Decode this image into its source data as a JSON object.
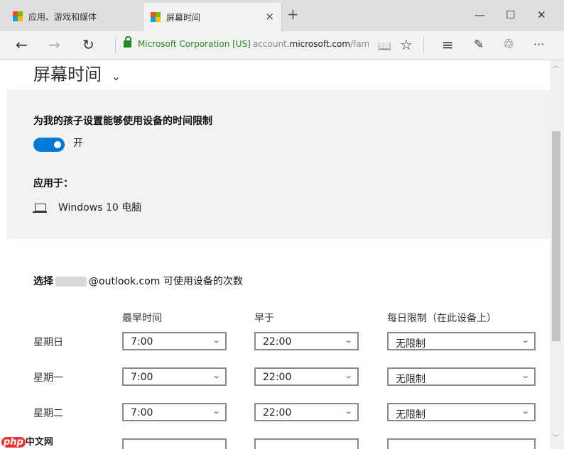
{
  "tabs": [
    {
      "label": "应用、游戏和媒体",
      "active": false
    },
    {
      "label": "屏幕时间",
      "active": true
    }
  ],
  "tab_close": "×",
  "new_tab": "+",
  "window_controls": {
    "minimize": "—",
    "maximize": "☐",
    "close": "✕"
  },
  "nav": {
    "back": "←",
    "forward": "→",
    "refresh": "↻",
    "cert_label": "Microsoft Corporation [US]",
    "url_prefix": "account.",
    "url_domain": "microsoft.com",
    "url_path": "/family",
    "reading_view": "📖",
    "favorite": "☆",
    "hub": "≡",
    "note": "✎",
    "share": "♲",
    "more": "···"
  },
  "page": {
    "title": "屏幕时间",
    "title_chevron": "⌄",
    "limit_heading": "为我的孩子设置能够使用设备的时间限制",
    "toggle": {
      "on": true,
      "label": "开"
    },
    "apply_heading": "应用于：",
    "device": "Windows 10 电脑",
    "schedule_heading_prefix": "选择",
    "schedule_heading_suffix": "@outlook.com 可使用设备的次数",
    "columns": [
      "最早时间",
      "早于",
      "每日限制（在此设备上）"
    ],
    "rows": [
      {
        "day": "星期日",
        "earliest": "7:00",
        "before": "22:00",
        "limit": "无限制"
      },
      {
        "day": "星期一",
        "earliest": "7:00",
        "before": "22:00",
        "limit": "无限制"
      },
      {
        "day": "星期二",
        "earliest": "7:00",
        "before": "22:00",
        "limit": "无限制"
      }
    ]
  },
  "watermark": {
    "logo": "php",
    "text": "中文网"
  },
  "icons": [
    "windows-logo-icon",
    "lock-icon",
    "laptop-icon",
    "chevron-down-icon"
  ],
  "colors": {
    "accent": "#0078d7",
    "secure": "#1e8c1e"
  }
}
